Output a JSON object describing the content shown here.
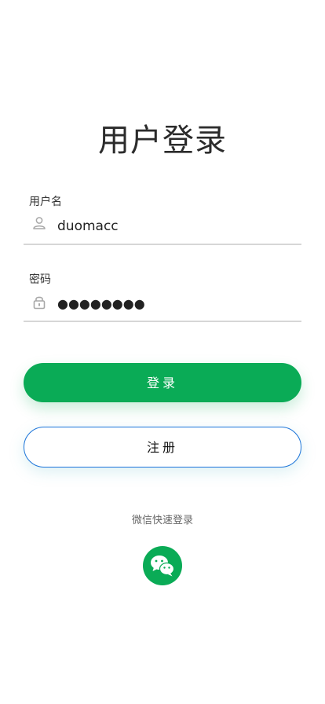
{
  "page": {
    "title": "用户登录"
  },
  "username": {
    "label": "用户名",
    "value": "duomacc",
    "icon": "user-icon"
  },
  "password": {
    "label": "密码",
    "value": "●●●●●●●●",
    "icon": "lock-icon"
  },
  "buttons": {
    "login_label": "登录",
    "register_label": "注册"
  },
  "quick_login": {
    "label": "微信快速登录",
    "icon": "wechat-icon"
  },
  "colors": {
    "primary": "#0aab56",
    "register_border": "#1a73d9",
    "divider": "#d6d6d6"
  }
}
